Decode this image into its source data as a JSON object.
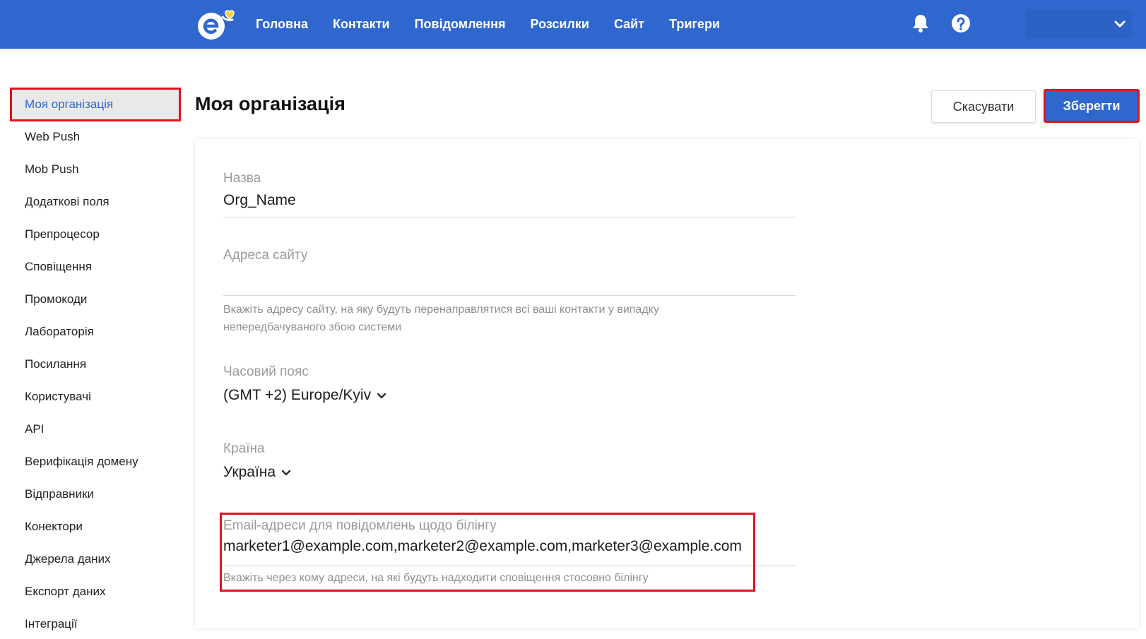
{
  "topbar": {
    "nav": [
      "Головна",
      "Контакти",
      "Повідомлення",
      "Розсилки",
      "Сайт",
      "Тригери"
    ],
    "colors": {
      "bar": "#2f67cf",
      "logo_heart": "#f5d33a"
    },
    "icons": [
      "logo-icon",
      "bell-icon",
      "help-icon",
      "chevron-down-icon"
    ]
  },
  "sidebar": {
    "items": [
      {
        "label": "Моя організація",
        "active": true
      },
      {
        "label": "Web Push"
      },
      {
        "label": "Mob Push"
      },
      {
        "label": "Додаткові поля"
      },
      {
        "label": "Препроцесор"
      },
      {
        "label": "Сповіщення"
      },
      {
        "label": "Промокоди"
      },
      {
        "label": "Лабораторія"
      },
      {
        "label": "Посилання"
      },
      {
        "label": "Користувачі"
      },
      {
        "label": "API"
      },
      {
        "label": "Верифікація домену"
      },
      {
        "label": "Відправники"
      },
      {
        "label": "Конектори"
      },
      {
        "label": "Джерела даних"
      },
      {
        "label": "Експорт даних"
      },
      {
        "label": "Інтеграції"
      }
    ]
  },
  "page": {
    "title": "Моя організація",
    "cancel_label": "Скасувати",
    "save_label": "Зберегти"
  },
  "form": {
    "name": {
      "label": "Назва",
      "value": "Org_Name"
    },
    "site": {
      "label": "Адреса сайту",
      "value": "",
      "hint_line1": "Вкажіть адресу сайту, на яку будуть перенаправлятися всі ваші контакти у випадку",
      "hint_line2": "непередбачуваного збою системи"
    },
    "timezone": {
      "label": "Часовий пояс",
      "value": "(GMT +2) Europe/Kyiv"
    },
    "country": {
      "label": "Країна",
      "value": "Україна"
    },
    "billing": {
      "label": "Email-адреси для повідомлень щодо білінгу",
      "value": "marketer1@example.com,marketer2@example.com,marketer3@example.com",
      "hint": "Вкажіть через кому адреси, на які будуть надходити сповіщення стосовно білінгу"
    }
  },
  "highlight_color": "#e0141e"
}
